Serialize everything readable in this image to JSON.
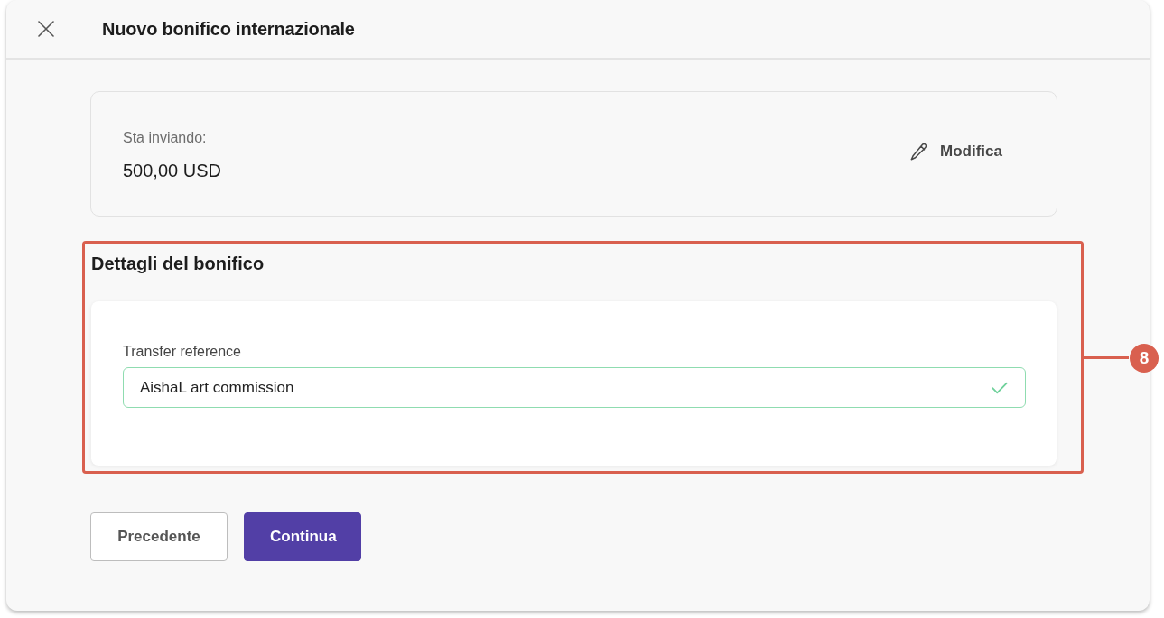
{
  "modal": {
    "title": "Nuovo bonifico internazionale"
  },
  "summary": {
    "label": "Sta inviando:",
    "amount": "500,00 USD",
    "edit_link": "Modifica"
  },
  "section": {
    "title": "Dettagli del bonifico",
    "highlighted": true,
    "field": {
      "label": "Transfer reference",
      "value": "AishaL art commission",
      "valid": true
    }
  },
  "callout": {
    "number": "8"
  },
  "buttons": [
    {
      "label": "Precedente",
      "kind": "secondary"
    },
    {
      "label": "Continua",
      "kind": "primary"
    }
  ]
}
